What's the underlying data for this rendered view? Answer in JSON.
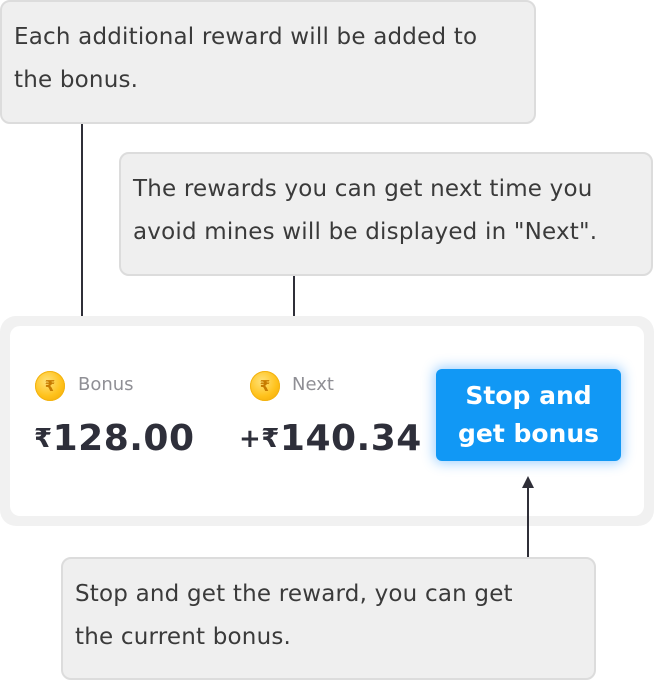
{
  "tooltips": {
    "bonus": {
      "line1": "Each additional reward will be added to",
      "line2": "the bonus."
    },
    "next": {
      "line1": "The rewards you can get next time you",
      "line2": "avoid mines will be displayed in \"Next\"."
    },
    "stop": {
      "line1": "Stop and get the reward, you can get",
      "line2": "the current bonus."
    }
  },
  "panel": {
    "bonus": {
      "icon": "rupee-coin-icon",
      "label": "Bonus",
      "currency": "₹",
      "amount": "128.00"
    },
    "next": {
      "icon": "rupee-coin-icon",
      "label": "Next",
      "prefix": "+",
      "currency": "₹",
      "amount": "140.34"
    },
    "stop_button": {
      "line1": "Stop and",
      "line2": "get bonus"
    }
  },
  "colors": {
    "accent": "#1198f5",
    "coin": "#ffc21c",
    "tooltip_bg": "#efefef"
  }
}
